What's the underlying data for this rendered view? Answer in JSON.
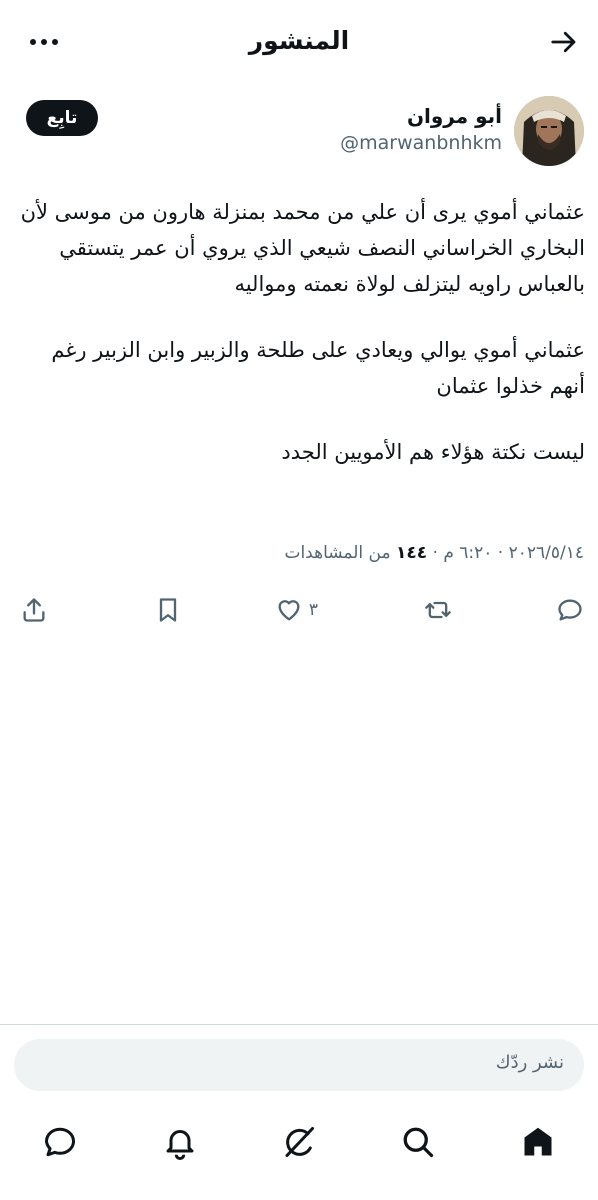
{
  "header": {
    "title": "المنشور",
    "back_icon": "arrow-right-icon",
    "more_icon": "more-dots-icon"
  },
  "author": {
    "name": "أبو مروان",
    "handle": "@marwanbnhkm",
    "follow_label": "تابِع"
  },
  "post": {
    "paragraphs": [
      "عثماني أموي يرى أن علي من محمد بمنزلة هارون من موسى لأن البخاري الخراساني النصف شيعي الذي يروي أن عمر يتستقي بالعباس  راويه ليتزلف لولاة نعمته ومواليه",
      "عثماني أموي يوالي ويعادي على طلحة والزبير وابن الزبير رغم أنهم خذلوا عثمان",
      "ليست نكتة هؤلاء هم الأمويين الجدد"
    ],
    "timestamp": "٢٠٢٦/٥/١٤ · ٦:٢٠ م · ",
    "views_count": "١٤٤",
    "views_label": " من المشاهدات"
  },
  "actions": {
    "reply_icon": "reply-icon",
    "repost_icon": "repost-icon",
    "like_icon": "heart-icon",
    "like_count": "٣",
    "bookmark_icon": "bookmark-icon",
    "share_icon": "share-icon"
  },
  "reply": {
    "placeholder": "نشر ردّك"
  },
  "bottom_nav": [
    "home-icon",
    "search-icon",
    "grok-icon",
    "notifications-icon",
    "messages-icon"
  ],
  "colors": {
    "text": "#0f1419",
    "secondary": "#536471",
    "input_bg": "#eff3f4",
    "divider": "#cfd9de"
  }
}
